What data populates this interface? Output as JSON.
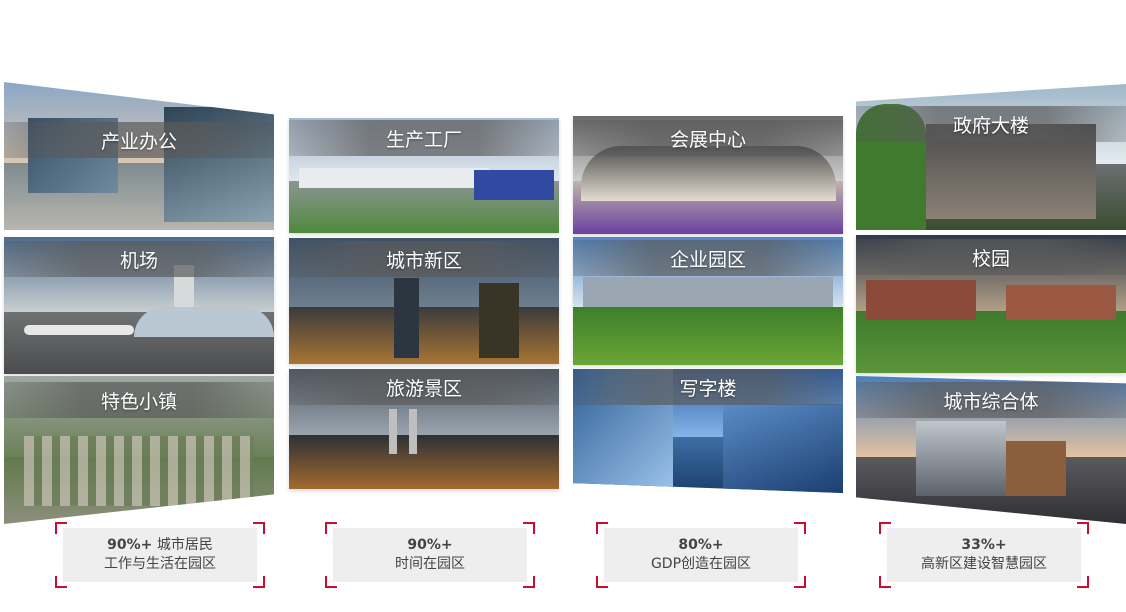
{
  "tiles": [
    {
      "label": "产业办公"
    },
    {
      "label": "生产工厂"
    },
    {
      "label": "会展中心"
    },
    {
      "label": "政府大楼"
    },
    {
      "label": "机场"
    },
    {
      "label": "城市新区"
    },
    {
      "label": "企业园区"
    },
    {
      "label": "校园"
    },
    {
      "label": "特色小镇"
    },
    {
      "label": "旅游景区"
    },
    {
      "label": "写字楼"
    },
    {
      "label": "城市综合体"
    }
  ],
  "stats": [
    {
      "value": "90%+",
      "text1": "城市居民",
      "text2": "工作与生活在园区"
    },
    {
      "value": "90%+",
      "text1": "",
      "text2": "时间在园区"
    },
    {
      "value": "80%+",
      "text1": "",
      "text2": "GDP创造在园区"
    },
    {
      "value": "33%+",
      "text1": "",
      "text2": "高新区建设智慧园区"
    }
  ]
}
